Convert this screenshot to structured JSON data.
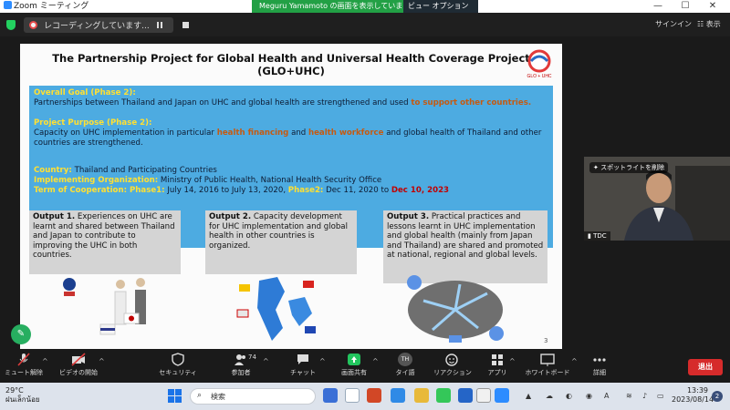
{
  "window": {
    "title": "Zoom ミーティング",
    "controls": [
      "—",
      "☐",
      "✕"
    ]
  },
  "share_banner": {
    "text": "Meguru Yamamoto の画面を表示しています",
    "view_options": "ビュー オプション"
  },
  "meeting_top": {
    "recording_text": "レコーディングしています...",
    "sign_in": "サインイン",
    "view": "表示"
  },
  "slide": {
    "title_line1": "The Partnership Project for Global Health and Universal Health Coverage Project",
    "title_line2": "(GLO+UHC)",
    "logo_text": "GLO + UHC",
    "goal_heading": "Overall Goal (Phase 2):",
    "goal_text": "Partnerships between Thailand and Japan on UHC and global health are strengthened and used",
    "goal_highlight": "to support other countries.",
    "purpose_heading": "Project Purpose (Phase 2):",
    "purpose_a": "Capacity on UHC implementation in particular",
    "purpose_hl1": "health financing",
    "purpose_b": "and",
    "purpose_hl2": "health workforce",
    "purpose_c": "and global health of Thailand and other countries are strengthened.",
    "country_label": "Country:",
    "country_value": "Thailand and Participating Countries",
    "org_label": "Implementing Organization:",
    "org_value": "Ministry of Public Health, National Health Security Office",
    "term_label": "Term of Cooperation: Phase1:",
    "term_phase1": "July 14, 2016 to July 13, 2020,",
    "term_phase2_label": "Phase2:",
    "term_phase2": "Dec 11, 2020 to",
    "term_end": "Dec 10, 2023",
    "outputs": [
      {
        "label": "Output 1.",
        "text": "Experiences on UHC are learnt and shared between Thailand and Japan to contribute to improving the UHC in both countries."
      },
      {
        "label": "Output 2.",
        "text": "Capacity development for UHC implementation and global health in other countries is organized."
      },
      {
        "label": "Output 3.",
        "text": "Practical practices and lessons learnt in UHC implementation and global health (mainly from Japan and Thailand) are shared and promoted at national, regional and global levels."
      }
    ],
    "page_number": "3"
  },
  "participant": {
    "spotlight": "スポットライトを削除",
    "name": "TDC"
  },
  "toolbar": {
    "mute": "ミュート解除",
    "video": "ビデオの開始",
    "security": "セキュリティ",
    "participants": "参加者",
    "participants_count": "74",
    "chat": "チャット",
    "share": "画面共有",
    "rename_initials": "TH",
    "rename": "タイ語",
    "reactions": "リアクション",
    "apps": "アプリ",
    "whiteboard": "ホワイトボード",
    "more": "詳細",
    "leave": "退出"
  },
  "taskbar": {
    "temp": "29°C",
    "weather": "ฝนเล็กน้อย",
    "search": "検索",
    "time": "13:39",
    "date": "2023/08/14",
    "notif": "2",
    "tray_a": "A"
  },
  "colors": {
    "goal_bg": "#4dabe1",
    "heading_yellow": "#ffe033",
    "highlight_orange": "#c55a11",
    "end_red": "#c00000",
    "share_green": "#22a045",
    "leave_red": "#d62b2b"
  }
}
